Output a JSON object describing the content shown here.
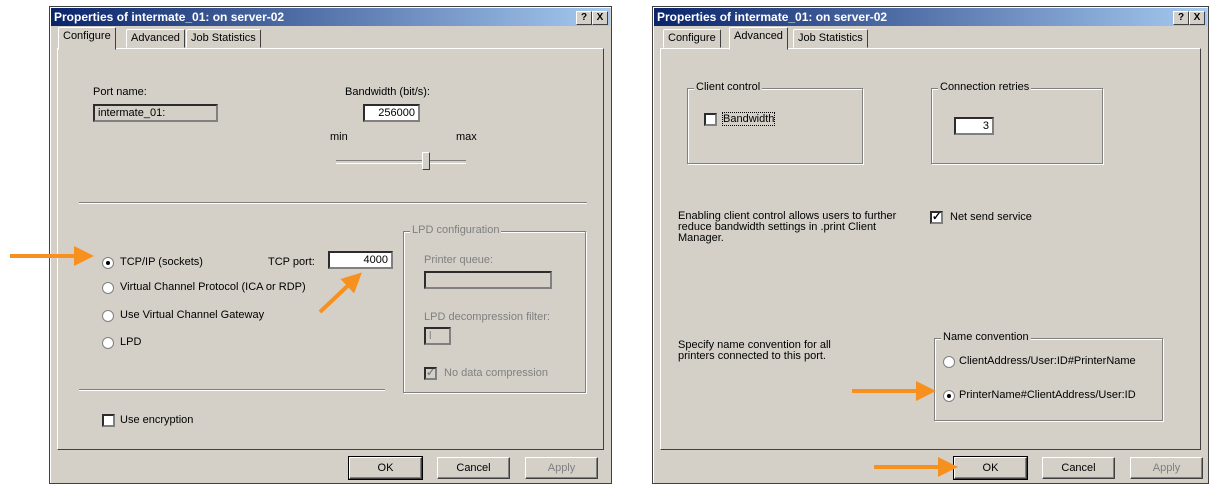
{
  "left": {
    "title": "Properties of intermate_01: on server-02",
    "help_btn": "?",
    "close_btn": "X",
    "tabs": [
      "Configure",
      "Advanced",
      "Job Statistics"
    ],
    "port_name_label": "Port name:",
    "port_name_value": "intermate_01:",
    "bandwidth_label": "Bandwidth (bit/s):",
    "bandwidth_value": "256000",
    "slider_min": "min",
    "slider_max": "max",
    "slider_level": 0.67,
    "radio_tcpip": "TCP/IP (sockets)",
    "tcp_port_label": "TCP port:",
    "tcp_port_value": "4000",
    "radio_vcp": "Virtual Channel Protocol (ICA or RDP)",
    "radio_vcg": "Use Virtual Channel Gateway",
    "radio_lpd": "LPD",
    "lpd_group_title": "LPD configuration",
    "printer_queue_label": "Printer queue:",
    "lpd_filter_label": "LPD decompression filter:",
    "lpd_filter_value": "l",
    "no_compression_label": "No data compression",
    "use_encryption_label": "Use encryption",
    "ok": "OK",
    "cancel": "Cancel",
    "apply": "Apply"
  },
  "right": {
    "title": "Properties of intermate_01: on server-02",
    "help_btn": "?",
    "close_btn": "X",
    "tabs": [
      "Configure",
      "Advanced",
      "Job Statistics"
    ],
    "client_control_title": "Client control",
    "bandwidth_check_label": "Bandwidth",
    "connection_retries_title": "Connection retries",
    "connection_retries_value": "3",
    "info_text_1": "Enabling client control allows users to further reduce bandwidth settings in .print Client Manager.",
    "net_send_label": "Net send service",
    "info_text_2": "Specify name convention for all printers connected to this port.",
    "name_convention_title": "Name convention",
    "radio_option_1": "ClientAddress/User:ID#PrinterName",
    "radio_option_2": "PrinterName#ClientAddress/User:ID",
    "ok": "OK",
    "cancel": "Cancel",
    "apply": "Apply"
  },
  "colors": {
    "titlebar_start": "#0a246a",
    "titlebar_end": "#a6caf0",
    "dialog_bg": "#d4d0c8",
    "arrow": "#f7901e"
  },
  "icons": [
    "arrow-icon"
  ]
}
